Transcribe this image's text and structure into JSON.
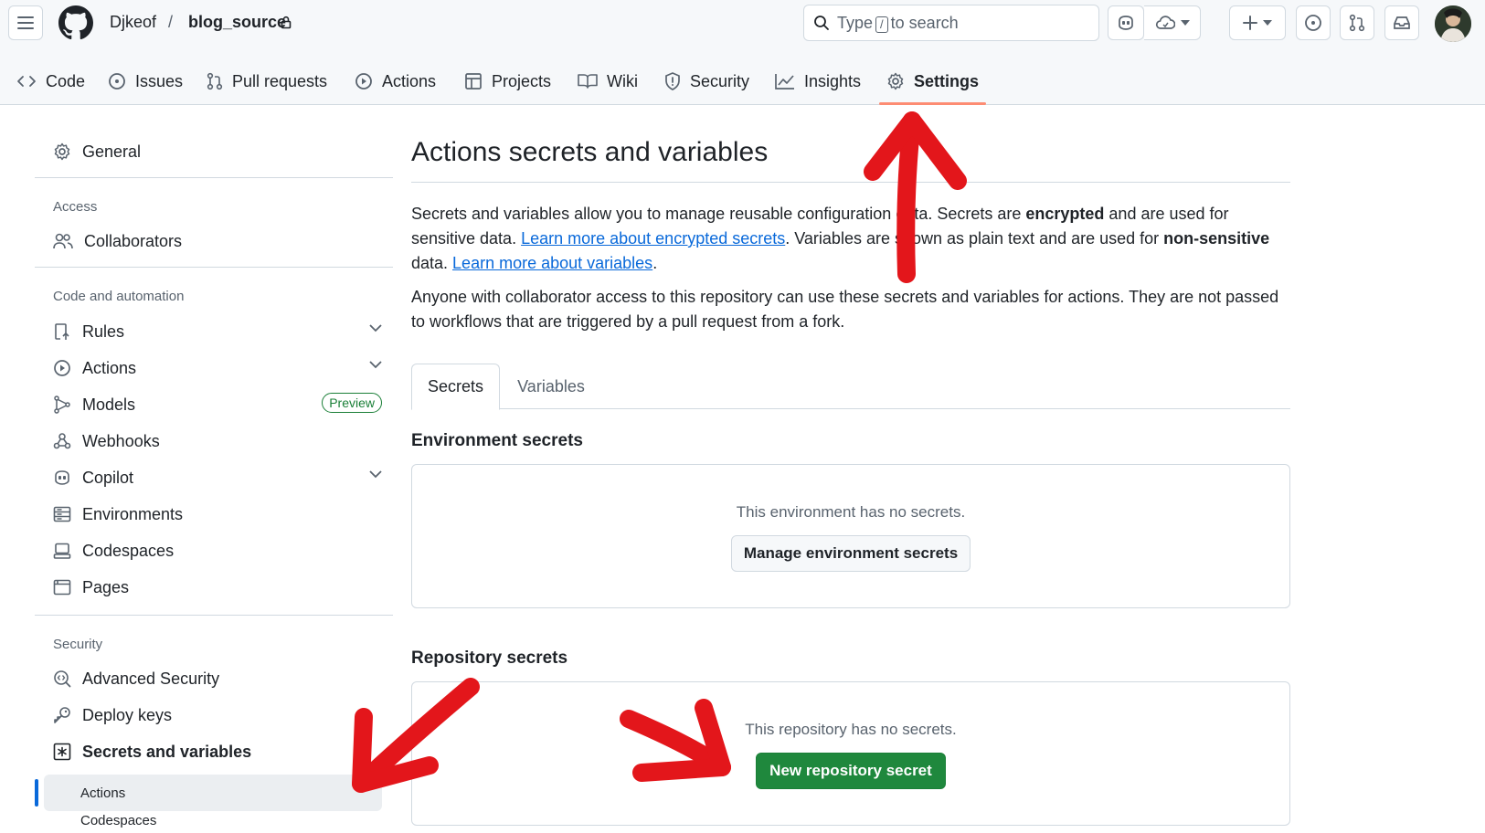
{
  "header": {
    "owner": "Djkeof",
    "separator": "/",
    "repo": "blog_source",
    "search": {
      "prefix": "Type",
      "key": "/",
      "suffix": "to search"
    }
  },
  "repo_tabs": [
    {
      "label": "Code",
      "icon": "code-icon"
    },
    {
      "label": "Issues",
      "icon": "issue-opened-icon"
    },
    {
      "label": "Pull requests",
      "icon": "git-pull-request-icon"
    },
    {
      "label": "Actions",
      "icon": "play-icon"
    },
    {
      "label": "Projects",
      "icon": "table-icon"
    },
    {
      "label": "Wiki",
      "icon": "book-icon"
    },
    {
      "label": "Security",
      "icon": "shield-icon"
    },
    {
      "label": "Insights",
      "icon": "graph-icon"
    },
    {
      "label": "Settings",
      "icon": "gear-icon",
      "active": true
    }
  ],
  "sidebar": {
    "general": "General",
    "access_heading": "Access",
    "collaborators": "Collaborators",
    "code_heading": "Code and automation",
    "rules": "Rules",
    "actions": "Actions",
    "models": "Models",
    "models_badge": "Preview",
    "webhooks": "Webhooks",
    "copilot": "Copilot",
    "environments": "Environments",
    "codespaces": "Codespaces",
    "pages": "Pages",
    "security_heading": "Security",
    "advanced_security": "Advanced Security",
    "deploy_keys": "Deploy keys",
    "secrets_and_variables": "Secrets and variables",
    "sub_actions": "Actions",
    "sub_codespaces": "Codespaces"
  },
  "main": {
    "title": "Actions secrets and variables",
    "intro": {
      "t1": "Secrets and variables allow you to manage reusable configuration data. Secrets are ",
      "b1": "encrypted",
      "t2": " and are used for sensitive data. ",
      "link1": "Learn more about encrypted secrets",
      "t3": ". Variables are shown as plain text and are used for ",
      "b2": "non-sensitive",
      "t4": " data. ",
      "link2": "Learn more about variables",
      "t5": "."
    },
    "access_note": "Anyone with collaborator access to this repository can use these secrets and variables for actions. They are not passed to workflows that are triggered by a pull request from a fork.",
    "tabs": [
      "Secrets",
      "Variables"
    ],
    "env_secrets": {
      "title": "Environment secrets",
      "empty": "This environment has no secrets.",
      "button": "Manage environment secrets"
    },
    "repo_secrets": {
      "title": "Repository secrets",
      "empty": "This repository has no secrets.",
      "button": "New repository secret"
    }
  },
  "colors": {
    "accent": "#0969da",
    "primary_button": "#1f883d",
    "active_tab_underline": "#fd8c73",
    "annotation": "#e3161b"
  }
}
